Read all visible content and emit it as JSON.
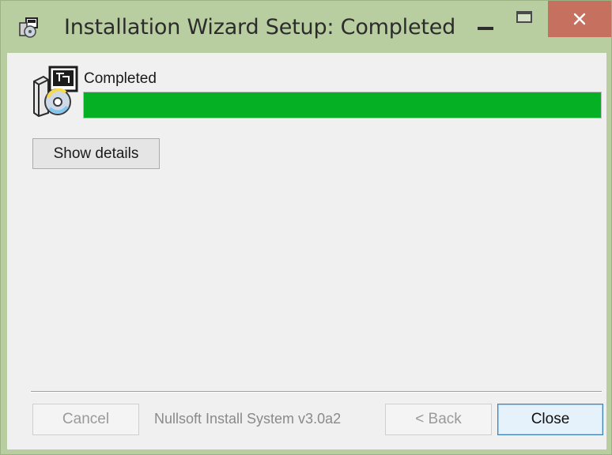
{
  "window": {
    "title": "Installation Wizard Setup: Completed",
    "icon": "installer-app-icon",
    "controls": {
      "minimize_icon": "minimize-icon",
      "maximize_icon": "maximize-icon",
      "close_icon": "close-icon"
    },
    "colors": {
      "frame": "#b8cda0",
      "close_button": "#c6715f",
      "client_background": "#f0f0f0"
    }
  },
  "status": {
    "label": "Completed",
    "icon": "installer-package-icon"
  },
  "progress": {
    "percent": 100,
    "color": "#06b025"
  },
  "buttons": {
    "show_details": "Show details",
    "cancel": "Cancel",
    "back": "< Back",
    "close": "Close"
  },
  "footer": {
    "branding": "Nullsoft Install System v3.0a2"
  }
}
